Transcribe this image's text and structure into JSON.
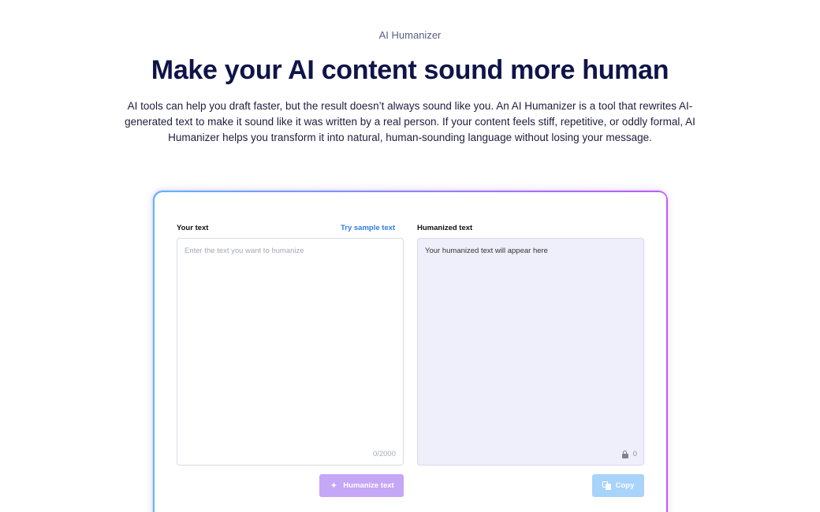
{
  "header": {
    "eyebrow": "AI Humanizer",
    "title": "Make your AI content sound more human",
    "intro": "AI tools can help you draft faster, but the result doesn’t always sound like you. An AI Humanizer is a tool that rewrites AI-generated text to make it sound like it was written by a real person. If your content feels stiff, repetitive, or oddly formal, AI Humanizer helps you transform it into natural, human-sounding language without losing your message."
  },
  "input_panel": {
    "label": "Your text",
    "sample_link": "Try sample text",
    "placeholder": "Enter the text you want to humanize",
    "value": "",
    "counter": "0/2000",
    "button_label": "Humanize text",
    "button_icon": "sparkle-icon"
  },
  "output_panel": {
    "label": "Humanized text",
    "placeholder": "Your humanized text will appear here",
    "counter": "0",
    "counter_icon": "lock-icon",
    "button_label": "Copy",
    "button_icon": "copy-icon"
  },
  "colors": {
    "heading": "#0f1448",
    "link": "#2f7fe0",
    "humanize_button": "#c6a6f6",
    "copy_button": "#a8d3fa",
    "output_background": "#efeffb",
    "card_border_gradient": [
      "#5fb6f8",
      "#9b7cf6",
      "#c45bf0"
    ]
  }
}
